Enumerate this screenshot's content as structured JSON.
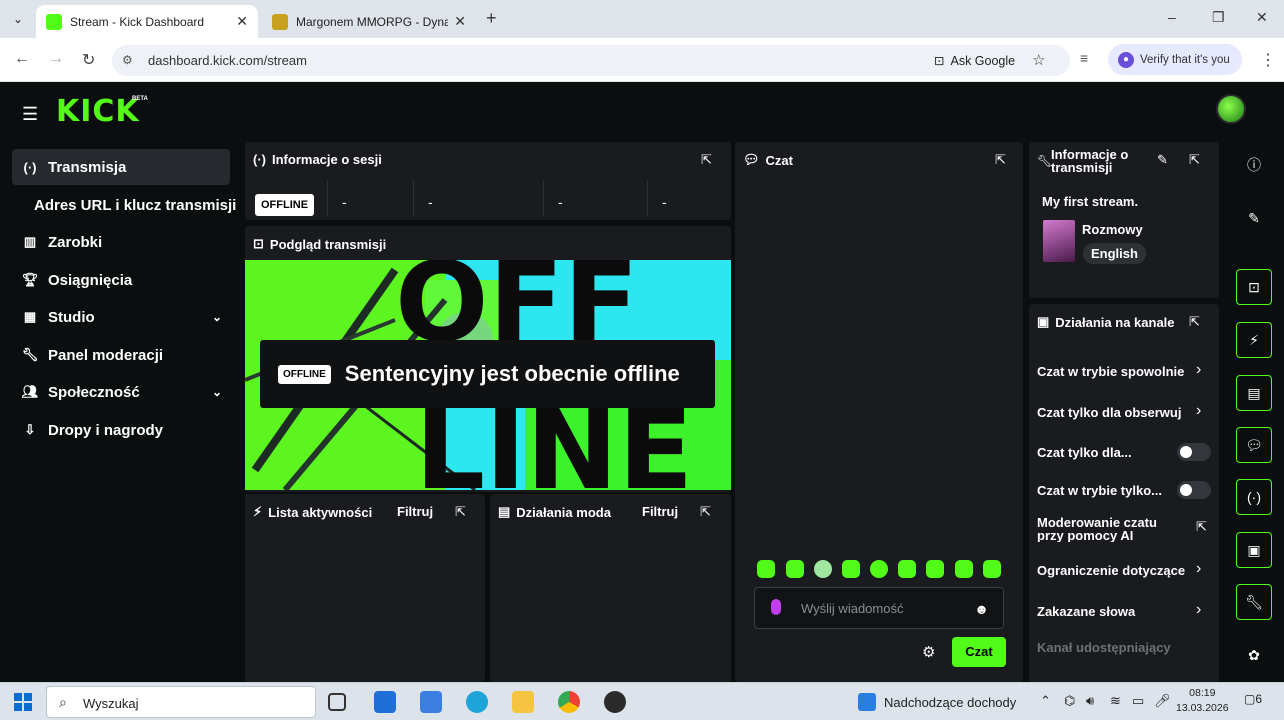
{
  "browser": {
    "tabs": [
      {
        "title": "Stream - Kick Dashboard",
        "active": true
      },
      {
        "title": "Margonem MMORPG - Dynamic",
        "active": false
      }
    ],
    "url": "dashboard.kick.com/stream",
    "ask_google": "Ask Google",
    "verify": "Verify that it's you",
    "new_tab": "+",
    "minimize": "–",
    "maximize": "❐",
    "close": "✕"
  },
  "app": {
    "logo": "KICK",
    "beta": "BETA",
    "colors": {
      "accent": "#53fc18",
      "panel": "#191b1f",
      "bg": "#0b0e0f"
    }
  },
  "sidebar": {
    "items": [
      {
        "label": "Transmisja",
        "icon": "broadcast-icon"
      },
      {
        "label": "Zarobki",
        "icon": "chart-icon"
      },
      {
        "label": "Osiągnięcia",
        "icon": "trophy-icon"
      },
      {
        "label": "Studio",
        "icon": "studio-icon"
      },
      {
        "label": "Panel moderacji",
        "icon": "wrench-icon"
      },
      {
        "label": "Społeczność",
        "icon": "community-icon"
      },
      {
        "label": "Dropy i nagrody",
        "icon": "drops-icon"
      }
    ],
    "sub_item": "Adres URL i klucz transmisji"
  },
  "session": {
    "title": "Informacje o sesji",
    "status": "OFFLINE",
    "stats": [
      "-",
      "-",
      "-",
      "-"
    ]
  },
  "preview": {
    "title": "Podgląd transmisji",
    "badge": "OFFLINE",
    "message": "Sentencyjny jest obecnie offline"
  },
  "activity": {
    "title": "Lista aktywności",
    "filter": "Filtruj"
  },
  "mod_actions": {
    "title": "Działania moda",
    "filter": "Filtruj"
  },
  "chat": {
    "title": "Czat",
    "placeholder": "Wyślij wiadomość",
    "send": "Czat"
  },
  "stream_info": {
    "title_line1": "Informacje o",
    "title_line2": "transmisji",
    "stream_title": "My first stream.",
    "category": "Rozmowy",
    "language": "English"
  },
  "channel_actions": {
    "title": "Działania na kanale",
    "items": [
      {
        "label": "Czat w trybie spowolnie",
        "control": "chevron"
      },
      {
        "label": "Czat tylko dla obserwuj",
        "control": "chevron"
      },
      {
        "label": "Czat tylko dla...",
        "control": "toggle"
      },
      {
        "label": "Czat w trybie tylko...",
        "control": "toggle"
      },
      {
        "label_line1": "Moderowanie czatu",
        "label_line2": "przy pomocy AI",
        "control": "external"
      },
      {
        "label": "Ograniczenie dotyczące",
        "control": "chevron"
      },
      {
        "label": "Zakazane słowa",
        "control": "chevron"
      }
    ],
    "dim_label": "Kanał udostępniający"
  },
  "taskbar": {
    "search": "Wyszukaj",
    "news": "Nadchodzące dochody",
    "time": "08:19",
    "date": "13.03.2026",
    "notifications": "6"
  }
}
